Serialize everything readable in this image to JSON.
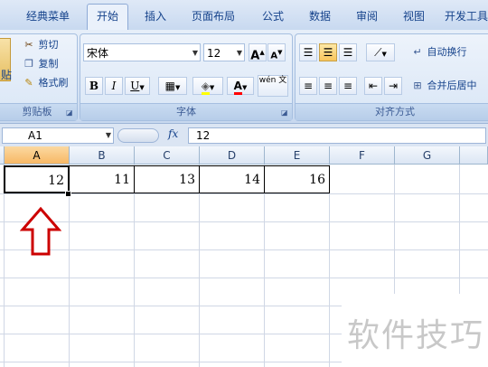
{
  "tabs": [
    "经典菜单",
    "开始",
    "插入",
    "页面布局",
    "公式",
    "数据",
    "审阅",
    "视图",
    "开发工具"
  ],
  "active_tab": "开始",
  "clipboard": {
    "paste_partial": "贴",
    "cut": "剪切",
    "copy": "复制",
    "format_painter": "格式刷",
    "label": "剪贴板"
  },
  "font": {
    "name": "宋体",
    "size": "12",
    "grow": "A",
    "shrink": "A",
    "bold": "B",
    "italic": "I",
    "underline": "U",
    "font_color": "A",
    "phonetic": "wén 文",
    "label": "字体"
  },
  "alignment": {
    "wrap_text": "自动换行",
    "merge_center": "合并后居中",
    "label": "对齐方式"
  },
  "formula_bar": {
    "name_box": "A1",
    "fx": "fx",
    "value": "12"
  },
  "columns": [
    "A",
    "B",
    "C",
    "D",
    "E",
    "F",
    "G"
  ],
  "row1": [
    "12",
    "11",
    "13",
    "14",
    "16"
  ],
  "watermark": "软件技巧",
  "colors": {
    "accent_arrow": "#cc0000",
    "selected_header": "#f7b865"
  }
}
